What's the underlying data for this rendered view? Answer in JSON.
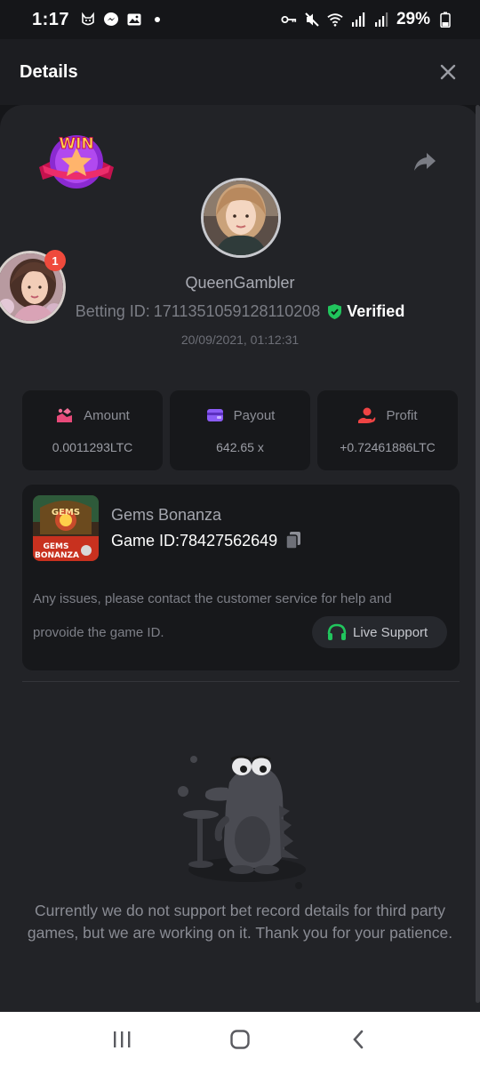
{
  "status_bar": {
    "time": "1:17",
    "battery": "29%",
    "icons": [
      "cat-icon",
      "messenger-icon",
      "gallery-icon",
      "dot-icon",
      "vpn-key-icon",
      "mute-icon",
      "wifi-icon",
      "signal-icon",
      "signal-icon",
      "battery-icon"
    ]
  },
  "header": {
    "title": "Details",
    "close_icon": "close-icon"
  },
  "profile": {
    "username": "QueenGambler",
    "betting_id_label": "Betting ID:",
    "betting_id": "1711351059128110208",
    "verified_label": "Verified",
    "datetime": "20/09/2021, 01:12:31",
    "notification_count": "1",
    "win_badge_text": "WIN"
  },
  "stats": [
    {
      "label": "Amount",
      "value": "0.0011293LTC",
      "icon": "amount-icon"
    },
    {
      "label": "Payout",
      "value": "642.65 x",
      "icon": "wallet-icon"
    },
    {
      "label": "Profit",
      "value": "+0.72461886LTC",
      "icon": "profit-icon"
    }
  ],
  "game": {
    "name": "Gems Bonanza",
    "id_label": "Game ID:",
    "id": "78427562649",
    "thumb_text_1": "GEMS",
    "thumb_text_2": "BONANZA",
    "help_line_1": "Any issues, please contact the customer service for help and",
    "help_line_2": "provoide the game ID.",
    "support_label": "Live Support"
  },
  "empty_state": {
    "message": "Currently we do not support bet record details for third party games, but we are working on it. Thank you for your patience."
  },
  "colors": {
    "background": "#151619",
    "sheet": "#222327",
    "card": "#17181b",
    "verified_green": "#21c55d",
    "accent_pink": "#e84a7a",
    "accent_purple": "#8b5cf6",
    "accent_red": "#ef4444"
  }
}
